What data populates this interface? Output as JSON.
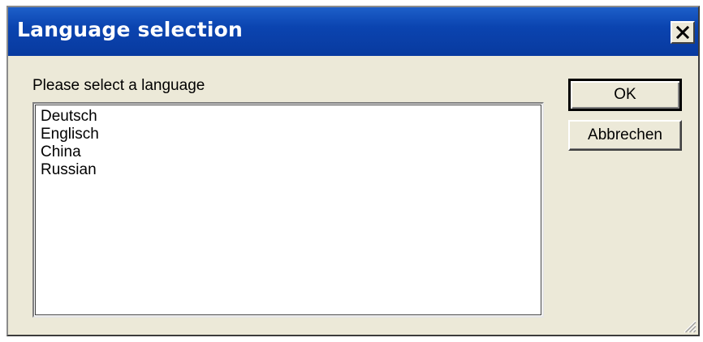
{
  "window": {
    "title": "Language selection",
    "close_icon": "close-icon"
  },
  "prompt": "Please select a language",
  "languages": [
    "Deutsch",
    "Englisch",
    "China",
    "Russian"
  ],
  "buttons": {
    "ok_label": "OK",
    "cancel_label": "Abbrechen"
  },
  "colors": {
    "titlebar": "#0b44b0",
    "dialog_face": "#ece9d8"
  }
}
